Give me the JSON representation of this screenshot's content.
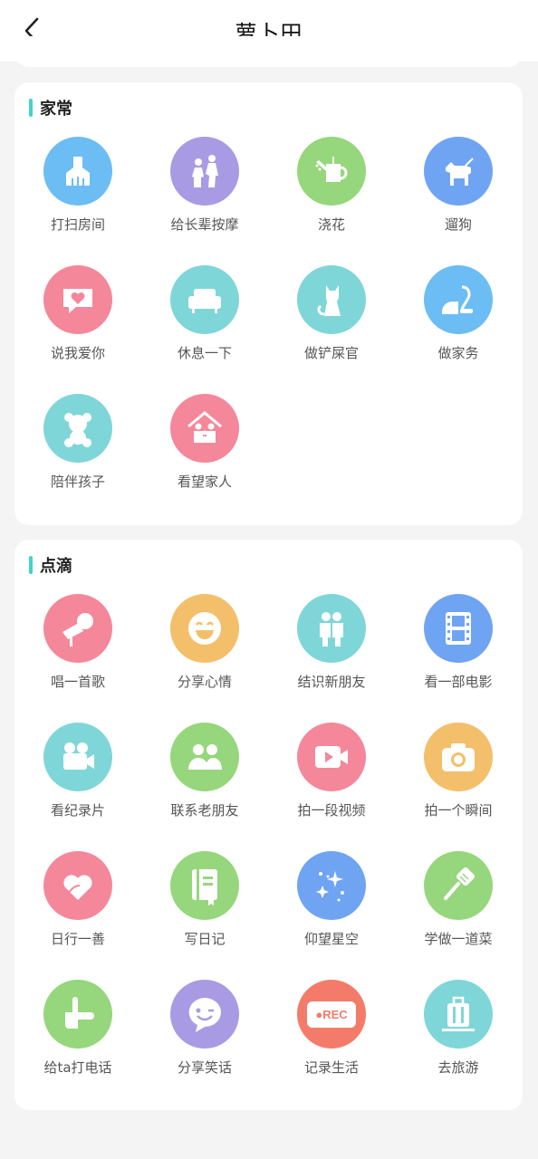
{
  "header": {
    "title": "萝卜田"
  },
  "sections": [
    {
      "title": "家常",
      "items": [
        {
          "label": "打扫房间",
          "icon": "broom-icon",
          "color": "#6bbdf3"
        },
        {
          "label": "给长辈按摩",
          "icon": "massage-icon",
          "color": "#a99be3"
        },
        {
          "label": "浇花",
          "icon": "watering-can-icon",
          "color": "#96d67c"
        },
        {
          "label": "遛狗",
          "icon": "dog-icon",
          "color": "#6fa4f2"
        },
        {
          "label": "说我爱你",
          "icon": "heart-message-icon",
          "color": "#f5879a"
        },
        {
          "label": "休息一下",
          "icon": "sofa-icon",
          "color": "#7fd6d8"
        },
        {
          "label": "做铲屎官",
          "icon": "cat-icon",
          "color": "#7fd6d8"
        },
        {
          "label": "做家务",
          "icon": "vacuum-icon",
          "color": "#6bbdf3"
        },
        {
          "label": "陪伴孩子",
          "icon": "teddy-bear-icon",
          "color": "#7fd6d8"
        },
        {
          "label": "看望家人",
          "icon": "family-house-icon",
          "color": "#f5879a"
        }
      ]
    },
    {
      "title": "点滴",
      "items": [
        {
          "label": "唱一首歌",
          "icon": "microphone-icon",
          "color": "#f5879a"
        },
        {
          "label": "分享心情",
          "icon": "smile-icon",
          "color": "#f3bf6a"
        },
        {
          "label": "结识新朋友",
          "icon": "friends-icon",
          "color": "#7fd6d8"
        },
        {
          "label": "看一部电影",
          "icon": "film-icon",
          "color": "#6fa4f2"
        },
        {
          "label": "看纪录片",
          "icon": "video-camera-icon",
          "color": "#7fd6d8"
        },
        {
          "label": "联系老朋友",
          "icon": "people-icon",
          "color": "#96d67c"
        },
        {
          "label": "拍一段视频",
          "icon": "video-play-icon",
          "color": "#f5879a"
        },
        {
          "label": "拍一个瞬间",
          "icon": "camera-icon",
          "color": "#f3bf6a"
        },
        {
          "label": "日行一善",
          "icon": "heart-hand-icon",
          "color": "#f5879a"
        },
        {
          "label": "写日记",
          "icon": "diary-icon",
          "color": "#96d67c"
        },
        {
          "label": "仰望星空",
          "icon": "stars-icon",
          "color": "#6fa4f2"
        },
        {
          "label": "学做一道菜",
          "icon": "spatula-icon",
          "color": "#96d67c"
        },
        {
          "label": "给ta打电话",
          "icon": "phone-hand-icon",
          "color": "#96d67c"
        },
        {
          "label": "分享笑话",
          "icon": "wink-chat-icon",
          "color": "#a99be3"
        },
        {
          "label": "记录生活",
          "icon": "rec-icon",
          "color": "#f47b6a",
          "badge": "●REC"
        },
        {
          "label": "去旅游",
          "icon": "luggage-icon",
          "color": "#7fd6d8"
        }
      ]
    }
  ]
}
